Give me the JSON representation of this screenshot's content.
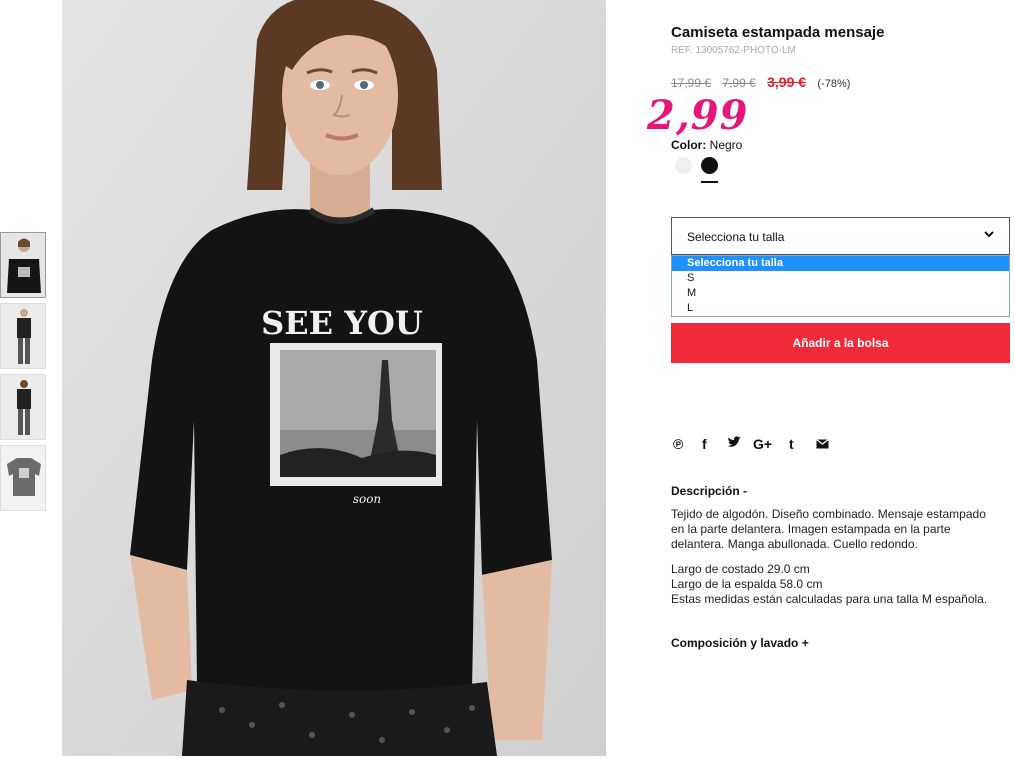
{
  "product": {
    "title": "Camiseta estampada mensaje",
    "ref": "REF. 13005762-PHOTO-LM",
    "price_original_1": "17,99 €",
    "price_original_2": "7,99 €",
    "price_sale": "3,99 €",
    "discount": "(-78%)",
    "handwritten_price": "2,99",
    "color_label": "Color:",
    "color_value": "Negro",
    "shirt_print_line1": "SEE YOU",
    "shirt_print_line2": "soon"
  },
  "swatches": [
    {
      "name": "white",
      "color": "#efefef"
    },
    {
      "name": "black",
      "color": "#111111"
    }
  ],
  "size_select": {
    "label": "Selecciona tu talla",
    "options": [
      "Selecciona tu talla",
      "S",
      "M",
      "L"
    ],
    "selected_index": 0
  },
  "add_button": "Añadir a la bolsa",
  "social_icons": [
    "pinterest-icon",
    "facebook-icon",
    "twitter-icon",
    "google-plus-icon",
    "tumblr-icon",
    "email-icon"
  ],
  "description": {
    "heading": "Descripción -",
    "paragraph": "Tejido de algodón. Diseño combinado. Mensaje estampado en la parte delantera. Imagen estampada en la parte delantera. Manga abullonada. Cuello redondo.",
    "measure_1": "Largo de costado 29.0 cm",
    "measure_2": "Largo de la espalda 58.0 cm",
    "measure_3": "Estas medidas están calculadas para una talla M española."
  },
  "composition": {
    "heading": "Composición y lavado +"
  },
  "colors": {
    "accent_red": "#f12a3a",
    "sale_red": "#e2202b",
    "handwritten_pink": "#e5157a",
    "select_blue": "#1e90ff"
  }
}
